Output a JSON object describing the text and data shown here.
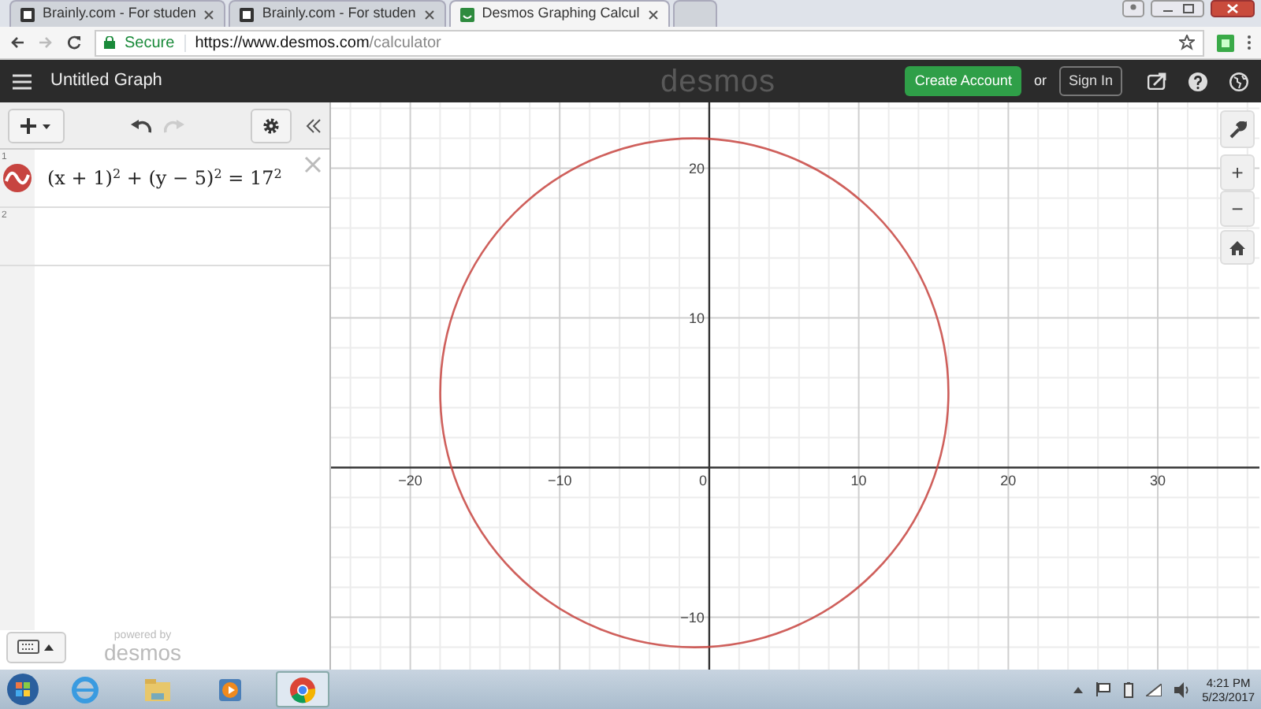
{
  "browser": {
    "tabs": [
      {
        "title": "Brainly.com - For studen",
        "kind": "brainly",
        "selected": false
      },
      {
        "title": "Brainly.com - For studen",
        "kind": "brainly",
        "selected": false
      },
      {
        "title": "Desmos Graphing Calcul",
        "kind": "desmos",
        "selected": true
      }
    ],
    "address": {
      "secure_label": "Secure",
      "url_host": "https://www.desmos.com",
      "url_path": "/calculator"
    }
  },
  "app": {
    "title": "Untitled Graph",
    "logo": "desmos",
    "create_account": "Create Account",
    "or": "or",
    "sign_in": "Sign In"
  },
  "expressions": [
    {
      "number": "1",
      "text": "(x + 1)$^{2}$ + (y − 5)$^{2}$ = 17$^{2}$",
      "color": "#c74440"
    },
    {
      "number": "2"
    }
  ],
  "powered_by": {
    "label": "powered by",
    "logo": "desmos"
  },
  "graph": {
    "controls": {
      "zoom_in": "+",
      "zoom_out": "−"
    },
    "chart_data": {
      "type": "line",
      "grid": true,
      "xlim": [
        -25.3,
        36.8
      ],
      "ylim": [
        -13.5,
        24.4
      ],
      "xticks": [
        -20,
        -10,
        0,
        10,
        20,
        30
      ],
      "yticks": [
        -10,
        10,
        20
      ]
    }
  },
  "taskbar": {
    "apps": [
      {
        "kind": "ie",
        "selected": false
      },
      {
        "kind": "explorer",
        "selected": false
      },
      {
        "kind": "media",
        "selected": false
      },
      {
        "kind": "chrome",
        "selected": true
      }
    ],
    "time": "4:21 PM",
    "date": "5/23/2017"
  }
}
